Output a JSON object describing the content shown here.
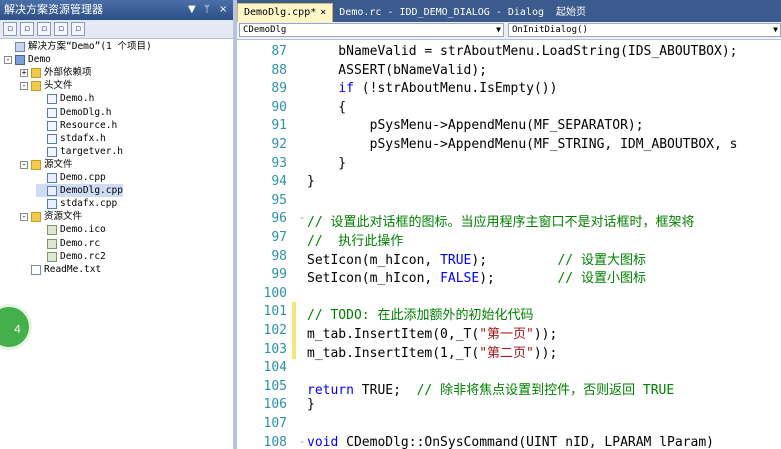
{
  "solution_panel": {
    "title": "解决方案资源管理器",
    "controls": [
      "▼",
      "ᛘ",
      "×"
    ],
    "toolbar_icons": [
      "properties-icon",
      "show-all-files-icon",
      "refresh-icon",
      "view-code-icon",
      "view-class-diagram-icon"
    ],
    "tree": [
      {
        "label": "解决方案“Demo”(1 个项目)",
        "icon": "solution-icon",
        "level": 0,
        "expander": ""
      },
      {
        "label": "Demo",
        "icon": "project-icon",
        "level": 0,
        "expander": "-"
      },
      {
        "label": "外部依赖项",
        "icon": "folder-icon",
        "level": 1,
        "expander": "+"
      },
      {
        "label": "头文件",
        "icon": "folder-icon",
        "level": 1,
        "expander": "-"
      },
      {
        "label": "Demo.h",
        "icon": "header-file-icon",
        "level": 2,
        "expander": ""
      },
      {
        "label": "DemoDlg.h",
        "icon": "header-file-icon",
        "level": 2,
        "expander": ""
      },
      {
        "label": "Resource.h",
        "icon": "header-file-icon",
        "level": 2,
        "expander": ""
      },
      {
        "label": "stdafx.h",
        "icon": "header-file-icon",
        "level": 2,
        "expander": ""
      },
      {
        "label": "targetver.h",
        "icon": "header-file-icon",
        "level": 2,
        "expander": ""
      },
      {
        "label": "源文件",
        "icon": "folder-icon",
        "level": 1,
        "expander": "-"
      },
      {
        "label": "Demo.cpp",
        "icon": "cpp-file-icon",
        "level": 2,
        "expander": ""
      },
      {
        "label": "DemoDlg.cpp",
        "icon": "cpp-file-icon",
        "level": 2,
        "expander": "",
        "selected": true
      },
      {
        "label": "stdafx.cpp",
        "icon": "cpp-file-icon",
        "level": 2,
        "expander": ""
      },
      {
        "label": "资源文件",
        "icon": "folder-icon",
        "level": 1,
        "expander": "-"
      },
      {
        "label": "Demo.ico",
        "icon": "resource-file-icon",
        "level": 2,
        "expander": ""
      },
      {
        "label": "Demo.rc",
        "icon": "resource-file-icon",
        "level": 2,
        "expander": ""
      },
      {
        "label": "Demo.rc2",
        "icon": "resource-file-icon",
        "level": 2,
        "expander": ""
      },
      {
        "label": "ReadMe.txt",
        "icon": "text-file-icon",
        "level": 1,
        "expander": ""
      }
    ]
  },
  "editor": {
    "tabs": [
      {
        "label": "DemoDlg.cpp*",
        "active": true,
        "close": "×"
      },
      {
        "label": "Demo.rc - IDD_DEMO_DIALOG - Dialog",
        "active": false,
        "close": ""
      },
      {
        "label": "起始页",
        "active": false,
        "close": ""
      }
    ],
    "class_combo": "CDemoDlg",
    "member_combo": "OnInitDialog()",
    "lines": [
      {
        "num": "87",
        "tokens": [
          [
            "",
            "    bNameValid = strAboutMenu.LoadString(IDS_ABOUTBOX);"
          ]
        ]
      },
      {
        "num": "88",
        "tokens": [
          [
            "",
            "    ASSERT(bNameValid);"
          ]
        ]
      },
      {
        "num": "89",
        "tokens": [
          [
            "",
            "    "
          ],
          [
            "kw",
            "if"
          ],
          [
            "",
            " (!strAboutMenu.IsEmpty())"
          ]
        ]
      },
      {
        "num": "90",
        "tokens": [
          [
            "",
            "    {"
          ]
        ]
      },
      {
        "num": "91",
        "tokens": [
          [
            "",
            "        pSysMenu->AppendMenu(MF_SEPARATOR);"
          ]
        ]
      },
      {
        "num": "92",
        "tokens": [
          [
            "",
            "        pSysMenu->AppendMenu(MF_STRING, IDM_ABOUTBOX, s"
          ]
        ]
      },
      {
        "num": "93",
        "tokens": [
          [
            "",
            "    }"
          ]
        ]
      },
      {
        "num": "94",
        "tokens": [
          [
            "",
            "}"
          ]
        ]
      },
      {
        "num": "95",
        "tokens": [
          [
            "",
            ""
          ]
        ]
      },
      {
        "num": "96",
        "tokens": [
          [
            "cm",
            "// 设置此对话框的图标。当应用程序主窗口不是对话框时，框架将"
          ]
        ],
        "outline": "-"
      },
      {
        "num": "97",
        "tokens": [
          [
            "cm",
            "//  执行此操作"
          ]
        ]
      },
      {
        "num": "98",
        "tokens": [
          [
            "",
            "SetIcon(m_hIcon, "
          ],
          [
            "kw",
            "TRUE"
          ],
          [
            "",
            ");         "
          ],
          [
            "cm",
            "// 设置大图标"
          ]
        ]
      },
      {
        "num": "99",
        "tokens": [
          [
            "",
            "SetIcon(m_hIcon, "
          ],
          [
            "kw",
            "FALSE"
          ],
          [
            "",
            ");        "
          ],
          [
            "cm",
            "// 设置小图标"
          ]
        ]
      },
      {
        "num": "100",
        "tokens": [
          [
            "",
            ""
          ]
        ]
      },
      {
        "num": "101",
        "tokens": [
          [
            "cm",
            "// TODO: 在此添加额外的初始化代码"
          ]
        ],
        "changed": true
      },
      {
        "num": "102",
        "tokens": [
          [
            "",
            "m_tab.InsertItem(0,_T("
          ],
          [
            "st",
            "\"第一页\""
          ],
          [
            "",
            "));"
          ]
        ],
        "changed": true
      },
      {
        "num": "103",
        "tokens": [
          [
            "",
            "m_tab.InsertItem(1,_T("
          ],
          [
            "st",
            "\"第二页\""
          ],
          [
            "",
            "));"
          ]
        ],
        "changed": true
      },
      {
        "num": "104",
        "tokens": [
          [
            "",
            ""
          ]
        ]
      },
      {
        "num": "105",
        "tokens": [
          [
            "kw",
            "return"
          ],
          [
            "",
            " TRUE;  "
          ],
          [
            "cm",
            "// 除非将焦点设置到控件，否则返回 TRUE"
          ]
        ]
      },
      {
        "num": "106",
        "tokens": [
          [
            "",
            "}"
          ]
        ]
      },
      {
        "num": "107",
        "tokens": [
          [
            "",
            ""
          ]
        ]
      },
      {
        "num": "108",
        "tokens": [
          [
            "kw",
            "void"
          ],
          [
            "",
            " CDemoDlg::OnSysCommand(UINT nID, LPARAM lParam)"
          ]
        ],
        "outline": "-"
      }
    ]
  },
  "side_badge": "4"
}
